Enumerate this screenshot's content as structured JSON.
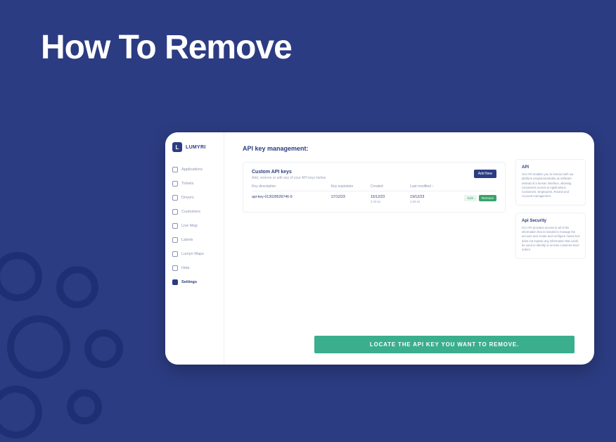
{
  "slide_title": "How To Remove",
  "brand": {
    "initial": "L",
    "name": "LUMYRI"
  },
  "sidebar": {
    "items": [
      {
        "label": "Applications"
      },
      {
        "label": "Tickets"
      },
      {
        "label": "Drivers"
      },
      {
        "label": "Customers"
      },
      {
        "label": "Live Map"
      },
      {
        "label": "Labels"
      },
      {
        "label": "Lumyri Maps"
      },
      {
        "label": "Help"
      },
      {
        "label": "Settings"
      }
    ],
    "active_index": 8
  },
  "page_title": "API key management:",
  "card": {
    "title": "Custom API keys",
    "subtitle": "Add, remove or edit any of your API keys below.",
    "add_label": "Add New",
    "columns": {
      "description": "Key description",
      "expiration": "Key expiration",
      "created": "Created",
      "modified": "Last modified ↑"
    },
    "row": {
      "description": "api-key-013028539746-9",
      "expiration": "17/12/23",
      "created": "15/12/23",
      "created_sub": "2:33:15",
      "modified": "19/12/23",
      "modified_sub": "4:33:15",
      "edit_label": "Edit",
      "remove_label": "Remove"
    }
  },
  "info": {
    "api": {
      "title": "API",
      "body": "Our API enables you to interact with our platform programmatically as software instead of a human interface, allowing convenient access to Applications, Customers, Employees, Routes and Account management."
    },
    "security": {
      "title": "Api Security",
      "body": "Our API provides access to all of the information that is needed to manage the account and create and configure routes but does not expose any information that could be used to identify or access customer-level orders."
    }
  },
  "cta_label": "LOCATE THE API KEY YOU WANT TO REMOVE."
}
